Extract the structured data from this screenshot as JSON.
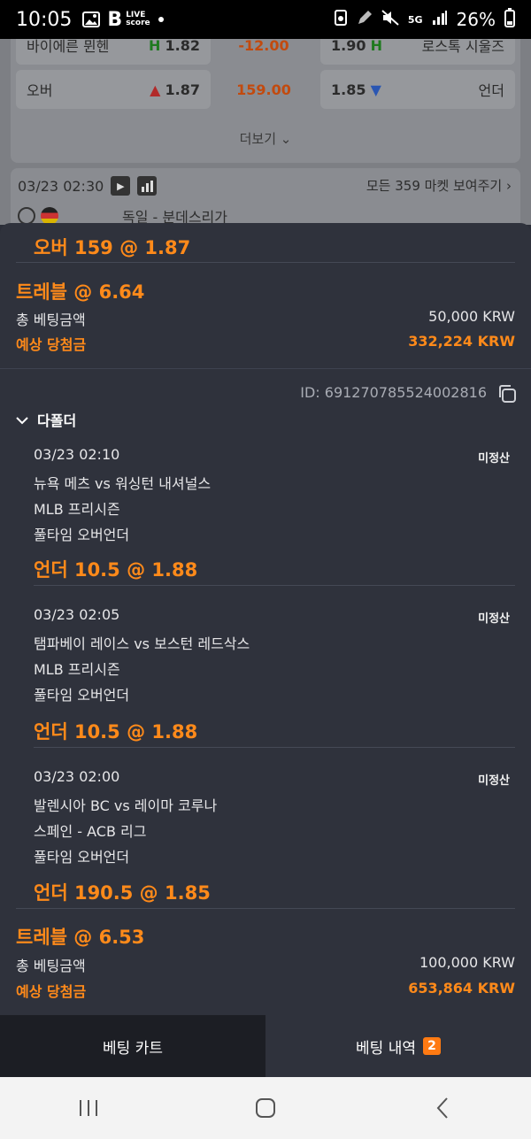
{
  "status": {
    "time": "10:05",
    "battery": "26%",
    "network": "5G",
    "app_logo_b": "B",
    "app_logo_text1": "LIVE",
    "app_logo_text2": "score"
  },
  "background": {
    "row1": {
      "team_left": "바이에른 뮌헨",
      "left_mark": "H",
      "left_odds": "1.82",
      "handicap": "-12.00",
      "right_odds": "1.90",
      "right_mark": "H",
      "team_right": "로스톡 시울즈"
    },
    "row2": {
      "left_label": "오버",
      "left_odds": "1.87",
      "total": "159.00",
      "right_odds": "1.85",
      "right_label": "언더"
    },
    "more_label": "더보기",
    "match_time": "03/23 02:30",
    "all_markets": "모든 359 마켓 보여주기",
    "league": "독일 - 분데스리가"
  },
  "sheet": {
    "top_pick": "오버 159 @ 1.87",
    "bet1": {
      "type_label": "트레블 @ 6.64",
      "stake_label": "총 베팅금액",
      "stake_value": "50,000 KRW",
      "win_label": "예상 당첨금",
      "win_value": "332,224 KRW"
    },
    "id_text": "ID: 691270785524002816",
    "section_label": "다폴더",
    "picks": [
      {
        "time": "03/23 02:10",
        "status": "미정산",
        "match": "뉴욕 메츠 vs 워싱턴 내셔널스",
        "league": "MLB 프리시즌",
        "market": "풀타임 오버언더",
        "selection": "언더 10.5 @ 1.88"
      },
      {
        "time": "03/23 02:05",
        "status": "미정산",
        "match": "탬파베이 레이스 vs 보스턴 레드삭스",
        "league": "MLB 프리시즌",
        "market": "풀타임 오버언더",
        "selection": "언더 10.5 @ 1.88"
      },
      {
        "time": "03/23 02:00",
        "status": "미정산",
        "match": "발렌시아 BC vs 레이마 코루나",
        "league": "스페인 - ACB 리그",
        "market": "풀타임 오버언더",
        "selection": "언더 190.5 @ 1.85"
      }
    ],
    "bet2": {
      "type_label": "트레블 @ 6.53",
      "stake_label": "총 베팅금액",
      "stake_value": "100,000 KRW",
      "win_label": "예상 당첨금",
      "win_value": "653,864 KRW"
    }
  },
  "tabs": {
    "cart": "베팅 카트",
    "history": "베팅 내역",
    "history_count": "2"
  },
  "colors": {
    "accent": "#ff8a1a",
    "sheet_bg": "#2f323c",
    "badge": "#ff7a12"
  }
}
